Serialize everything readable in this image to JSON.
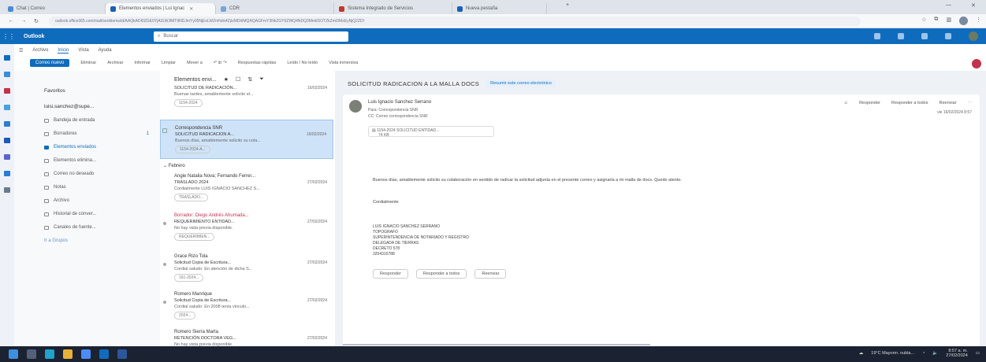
{
  "browser": {
    "tabs": [
      {
        "label": "Chat | Correo",
        "color": "#4a8bd6",
        "active": false
      },
      {
        "label": "Elementos enviados | Lui Ignac",
        "color": "#1b5fb4",
        "active": true
      },
      {
        "label": "CDR",
        "color": "#7aa4d8",
        "active": false
      },
      {
        "label": "Sistema Integrado de Servicios",
        "color": "#c0392b",
        "active": false
      },
      {
        "label": "Nueva pestaña",
        "color": "#1b5fb4",
        "active": false
      }
    ],
    "new_tab": "+",
    "url": "outlook.office365.com/mail/sentitems/id/AAQkADI0ZGE0YjA2LWJlMTItNDJmYy05NjExLWZmNzk4ZjIzMDhlMQAQAGFmY3NkZGY5ZWQ4NDQ3MmE5OTZkZmI3MzEyNjQ2ZDI"
  },
  "outlook": {
    "brand": "Outlook",
    "search_placeholder": "Buscar",
    "menu": [
      "Archivo",
      "Inicio",
      "Vista",
      "Ayuda"
    ],
    "menu_selected": 1,
    "new_mail": "Correo nuevo",
    "ribbon": [
      "Eliminar",
      "Archivar",
      "Informar",
      "Limpiar",
      "Mover a",
      "Respuestas rápidas",
      "Leído / No leído",
      "Vista inmersiva"
    ]
  },
  "folders": {
    "favorites": "Favoritos",
    "account": "luisi.sanchez@supe...",
    "items": [
      {
        "label": "Bandeja de entrada",
        "count": "",
        "selected": false
      },
      {
        "label": "Borradores",
        "count": "1",
        "selected": false
      },
      {
        "label": "Elementos enviados",
        "count": "",
        "selected": true
      },
      {
        "label": "Elementos elimina...",
        "count": "",
        "selected": false
      },
      {
        "label": "Correo no deseado",
        "count": "",
        "selected": false
      },
      {
        "label": "Notas",
        "count": "",
        "selected": false
      },
      {
        "label": "Archivo",
        "count": "",
        "selected": false
      },
      {
        "label": "Historial de conver...",
        "count": "",
        "selected": false
      },
      {
        "label": "Canales de fuente...",
        "count": "",
        "selected": false
      }
    ],
    "more": "Ir a Grupos"
  },
  "messages": {
    "header": "Elementos envi...",
    "group_label": "Febrero",
    "items": [
      {
        "sender": "",
        "subject": "SOLICITUD DE RADICACIÓN...",
        "time": "16/02/2024",
        "preview": "Buenas tardes, amablemente solicito el...",
        "chip": "1154-2024"
      },
      {
        "sender": "Correspondencia SNR",
        "subject": "SOLICITUD RADICACION A...",
        "time": "16/02/2024",
        "preview": "Buenos días, amablemente solicito su cola...",
        "chip": "1154-2024-A..."
      },
      {
        "sender": "Angie Natalia Nova; Fernando Ferrer...",
        "subject": "TRASLADO 2024",
        "time": "27/02/2024",
        "preview": "Cordialmente LUIS IGNACIO SANCHEZ S...",
        "chip": "TRASLADO..."
      },
      {
        "sender": "Borrador: Diego Andrés Ahumada...",
        "subject": "REQUERIMIENTO ENTIDAD...",
        "time": "27/02/2024",
        "preview": "No hay vista previa disponible.",
        "chip": "REQUERIMIEN..."
      },
      {
        "sender": "Grace Rizo Tola",
        "subject": "Solicitud Copia de Escritura...",
        "time": "27/02/2024",
        "preview": "Cordial saludo: En atención de dicha S...",
        "chip": "161-2024..."
      },
      {
        "sender": "Romero Manrique",
        "subject": "Solicitud Copia de Escritura...",
        "time": "27/02/2024",
        "preview": "Cordial saludo: En 2008 tenía vinculo...",
        "chip": "2024..."
      },
      {
        "sender": "Romero Sierra Marta",
        "subject": "RETENCIÓN DOCTORA VEG...",
        "time": "27/02/2024",
        "preview": "No hay vista previa disponible.",
        "chip": ""
      }
    ]
  },
  "reading": {
    "subject": "SOLICITUD RADICACION A LA MALLA DOCS",
    "summarize": "Resumir este correo electrónico",
    "sender": "Luis Ignacio Sanchez Serrano",
    "to": "Para: Correspondencia SNR",
    "cc": "CC: Correo correspondencia SNR",
    "attachment": "1154-2024 SOLICITUD ENTIDAD...",
    "attachment_size": "74 KB",
    "actions": [
      "Responder",
      "Responder a todos",
      "Reenviar"
    ],
    "date": "vie 16/02/2024 8:57",
    "body": "Buenos días, amablemente solicito su colaboración en sentido de radicar la solicitud adjunta en el presente correo y asignarla a mi malla de docs. Quedo atento.",
    "closing": "Cordialmente",
    "signature": [
      "LUIS IGNACIO SANCHEZ SERRANO",
      "TOPOGRAFO",
      "SUPERINTENDENCIA DE NOTARIADO Y REGISTRO",
      "DELEGADA DE TIERRAS",
      "DECRETO 578",
      "3204310788"
    ],
    "reply_buttons": [
      "Responder",
      "Responder a todos",
      "Reenviar"
    ]
  },
  "taskbar": {
    "weather": "19°C Mayorm. nubla...",
    "time": "8:57 a. m.",
    "date": "27/02/2024"
  }
}
